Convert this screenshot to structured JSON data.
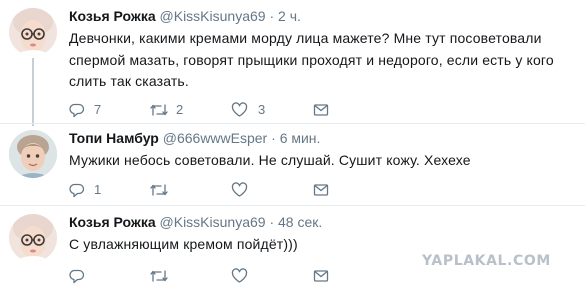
{
  "tweets": [
    {
      "name": "Козья Рожка",
      "handle": "@KissKisunya69",
      "dot": "·",
      "time": "2 ч.",
      "lines": [
        "Девчонки, какими кремами морду лица мажете? Мне тут посоветовали",
        "спермой мазать, говорят прыщики проходят и недорого, если есть у кого",
        "слить так сказать."
      ],
      "replies": "7",
      "retweets": "2",
      "likes": "3"
    },
    {
      "name": "Топи Намбур",
      "handle": "@666wwwEsper",
      "dot": "·",
      "time": "6 мин.",
      "lines": [
        "Мужики небось советовали. Не слушай. Сушит кожу. Хехехе"
      ],
      "replies": "1",
      "retweets": "",
      "likes": ""
    },
    {
      "name": "Козья Рожка",
      "handle": "@KissKisunya69",
      "dot": "·",
      "time": "48 сек.",
      "lines": [
        "С увлажняющим кремом пойдёт)))"
      ],
      "replies": "",
      "retweets": "",
      "likes": ""
    }
  ],
  "icons": {
    "reply": "reply-icon",
    "retweet": "retweet-icon",
    "like": "heart-icon",
    "dm": "envelope-icon"
  },
  "colors": {
    "text": "#14171a",
    "secondary": "#657786",
    "thread_line": "#c4cfd6",
    "divider": "#e6ecf0",
    "watermark": "#b8c1c9"
  },
  "watermark": "YAPLAKAL.COM"
}
